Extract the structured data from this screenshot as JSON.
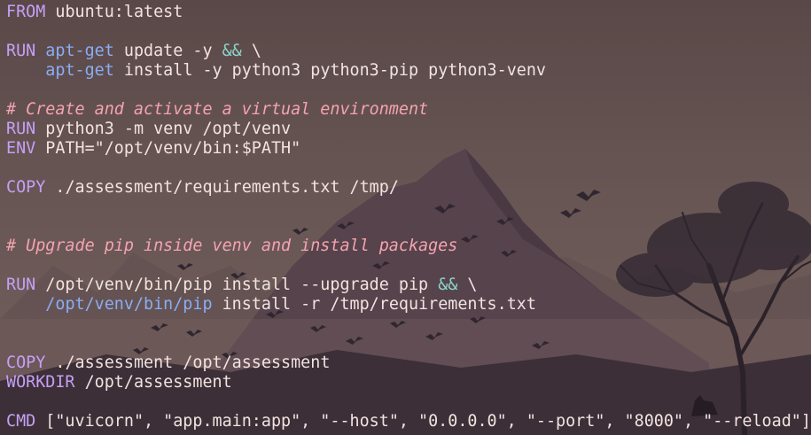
{
  "theme": {
    "keyword": "#c6a0f6",
    "command": "#8aadf4",
    "operator": "#8bd5ca",
    "comment": "#f5a3b0",
    "text": "#f2e3e0",
    "background_image": "mountain-with-birds-and-tree-wallpaper"
  },
  "lines": [
    [
      {
        "c": "kw",
        "t": "FROM"
      },
      {
        "c": "tx",
        "t": " ubuntu:latest"
      }
    ],
    [],
    [
      {
        "c": "kw",
        "t": "RUN"
      },
      {
        "c": "tx",
        "t": " "
      },
      {
        "c": "fn",
        "t": "apt-get"
      },
      {
        "c": "tx",
        "t": " update -y "
      },
      {
        "c": "op",
        "t": "&&"
      },
      {
        "c": "tx",
        "t": " \\"
      }
    ],
    [
      {
        "c": "tx",
        "t": "    "
      },
      {
        "c": "fn",
        "t": "apt-get"
      },
      {
        "c": "tx",
        "t": " install -y python3 python3-pip python3-venv"
      }
    ],
    [],
    [
      {
        "c": "cm",
        "t": "# Create and activate a virtual environment"
      }
    ],
    [
      {
        "c": "kw",
        "t": "RUN"
      },
      {
        "c": "tx",
        "t": " python3 -m venv /opt/venv"
      }
    ],
    [
      {
        "c": "kw",
        "t": "ENV"
      },
      {
        "c": "tx",
        "t": " PATH=\"/opt/venv/bin:$PATH\""
      }
    ],
    [],
    [
      {
        "c": "kw",
        "t": "COPY"
      },
      {
        "c": "tx",
        "t": " ./assessment/requirements.txt /tmp/"
      }
    ],
    [],
    [],
    [
      {
        "c": "cm",
        "t": "# Upgrade pip inside venv and install packages"
      }
    ],
    [],
    [
      {
        "c": "kw",
        "t": "RUN"
      },
      {
        "c": "tx",
        "t": " /opt/venv/bin/pip install --upgrade pip "
      },
      {
        "c": "op",
        "t": "&&"
      },
      {
        "c": "tx",
        "t": " \\"
      }
    ],
    [
      {
        "c": "tx",
        "t": "    "
      },
      {
        "c": "fn",
        "t": "/opt/venv/bin/pip"
      },
      {
        "c": "tx",
        "t": " install -r /tmp/requirements.txt"
      }
    ],
    [],
    [],
    [
      {
        "c": "kw",
        "t": "COPY"
      },
      {
        "c": "tx",
        "t": " ./assessment /opt/assessment"
      }
    ],
    [
      {
        "c": "kw",
        "t": "WORKDIR"
      },
      {
        "c": "tx",
        "t": " /opt/assessment"
      }
    ],
    [],
    [
      {
        "c": "kw",
        "t": "CMD"
      },
      {
        "c": "tx",
        "t": " [\"uvicorn\", \"app.main:app\", \"--host\", \"0.0.0.0\", \"--port\", \"8000\", \"--reload\"]"
      }
    ]
  ]
}
